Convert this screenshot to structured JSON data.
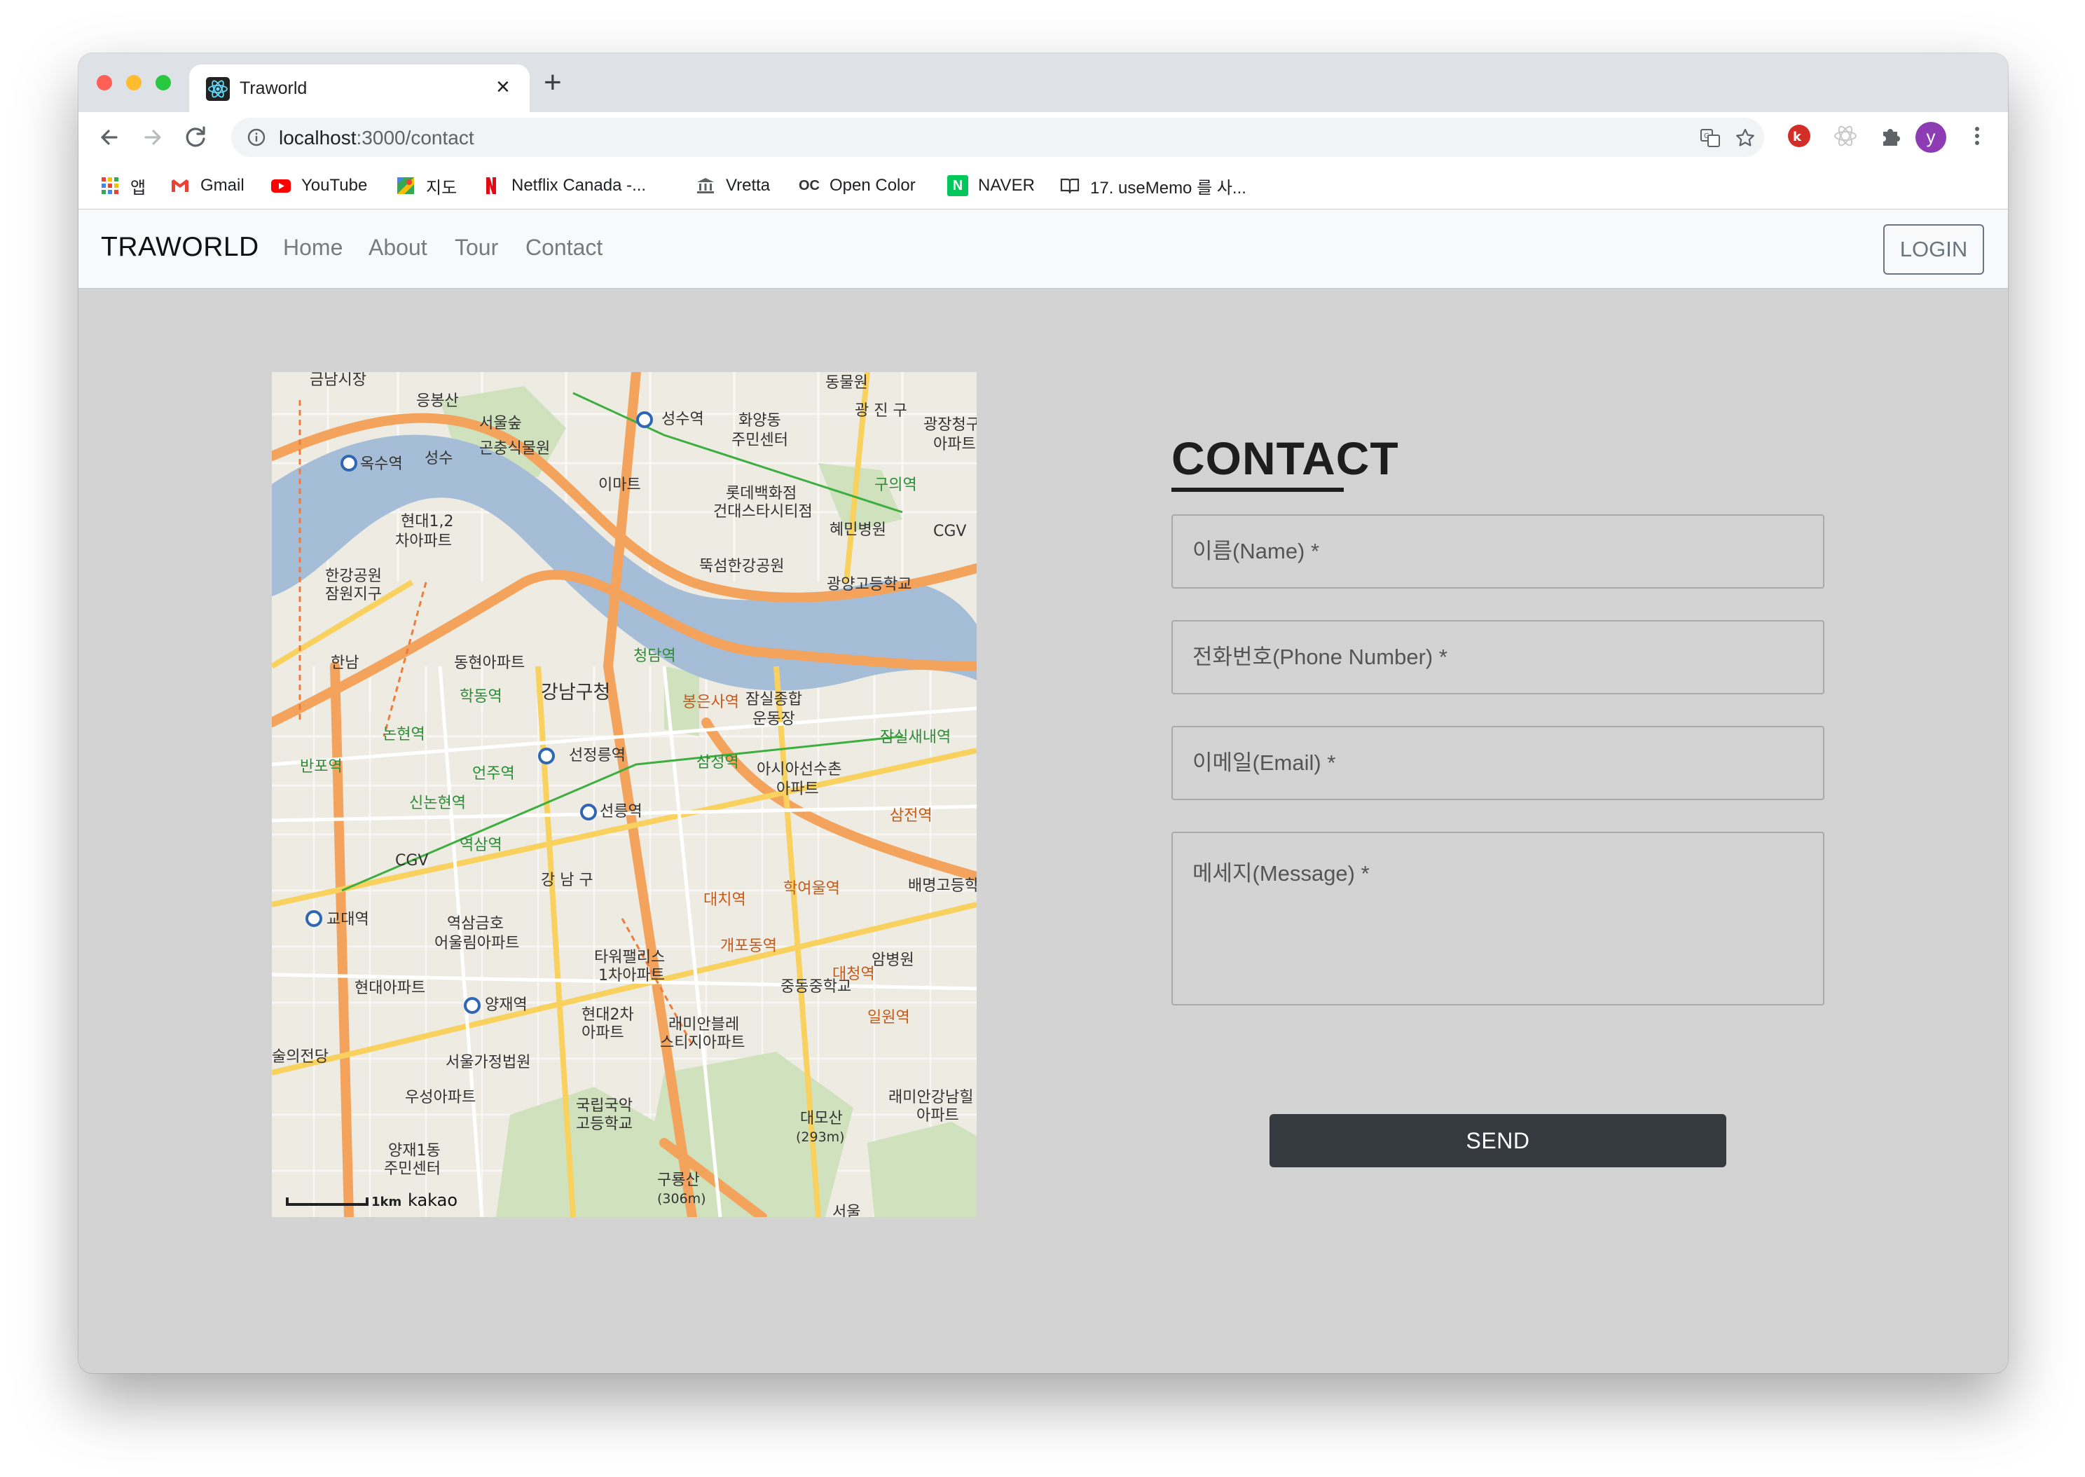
{
  "browser": {
    "tab": {
      "title": "Traworld",
      "close_glyph": "×",
      "favicon": "react-icon"
    },
    "new_tab_glyph": "+",
    "url": {
      "host": "localhost",
      "rest": ":3000/contact"
    },
    "avatar_initial": "y",
    "traffic_colors": {
      "close": "#ff5f57",
      "minimize": "#febc2e",
      "maximize": "#28c840"
    },
    "bookmarks": [
      {
        "label": "앱",
        "icon": "apps-grid-icon"
      },
      {
        "label": "Gmail",
        "icon": "gmail-icon"
      },
      {
        "label": "YouTube",
        "icon": "youtube-icon"
      },
      {
        "label": "지도",
        "icon": "maps-icon"
      },
      {
        "label": "Netflix Canada -...",
        "icon": "netflix-icon"
      },
      {
        "label": "Vretta",
        "icon": "bank-icon"
      },
      {
        "label": "Open Color",
        "icon": "oc-icon",
        "icon_text": "OC"
      },
      {
        "label": "NAVER",
        "icon": "naver-icon",
        "icon_text": "N"
      },
      {
        "label": "17. useMemo 를 사...",
        "icon": "book-icon"
      }
    ]
  },
  "app": {
    "brand": "TRAWORLD",
    "nav": [
      "Home",
      "About",
      "Tour",
      "Contact"
    ],
    "login_label": "LOGIN"
  },
  "map": {
    "provider": "kakao",
    "scale": "1km",
    "labels": [
      "금남시장",
      "응봉산",
      "서울숲",
      "성수역",
      "화양동",
      "주민센터",
      "동물원",
      "광 진 구",
      "광장청구",
      "아파트",
      "옥수역",
      "곤충식물원",
      "성수",
      "이마트",
      "롯데백화점",
      "건대스타시티점",
      "혜민병원",
      "구의역",
      "CGV",
      "현대1,2",
      "차아파트",
      "뚝섬한강공원",
      "광양고등학교",
      "한강공원",
      "잠원지구",
      "한남",
      "동현아파트",
      "청담역",
      "강남구청",
      "학동역",
      "봉은사역",
      "잠실종합",
      "운동장",
      "잠실새내역",
      "논현역",
      "선정릉역",
      "삼성역",
      "아시아선수촌",
      "아파트",
      "반포역",
      "언주역",
      "신논현역",
      "선릉역",
      "삼전역",
      "CGV",
      "역삼역",
      "강 남 구",
      "배명고등학교",
      "교대역",
      "대치역",
      "학여울역",
      "역삼금호",
      "어울림아파트",
      "타워팰리스",
      "1차아파트",
      "개포동역",
      "중동중학교",
      "암병원",
      "현대아파트",
      "양재역",
      "현대2차",
      "아파트",
      "래미안블레",
      "스티지아파트",
      "대청역",
      "일원역",
      "술의전당",
      "서울가정법원",
      "우성아파트",
      "국립국악",
      "고등학교",
      "대모산",
      "(293m)",
      "래미안강남힐",
      "아파트",
      "양재1동",
      "주민센터",
      "구룡산",
      "(306m)",
      "서울"
    ]
  },
  "contact": {
    "title": "CONTACT",
    "fields": {
      "name": "이름(Name) *",
      "phone": "전화번호(Phone Number) *",
      "email": "이메일(Email) *",
      "message": "메세지(Message) *"
    },
    "send_label": "SEND"
  }
}
